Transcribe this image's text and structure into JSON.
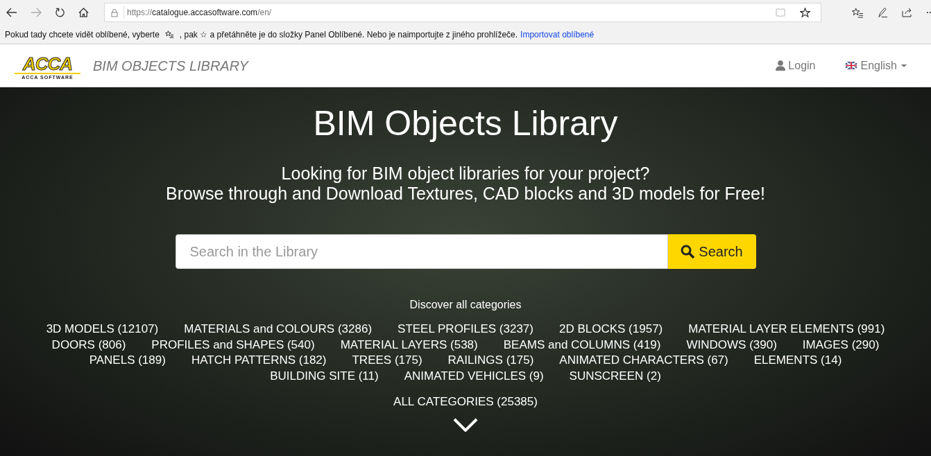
{
  "browser": {
    "url_prefix": "https://",
    "url_host": "catalogue.accasoftware.com",
    "url_path": "/en/"
  },
  "favorites_bar": {
    "text_before": "Pokud tady chcete vidět oblíbené, vyberte",
    "text_after": ", pak ☆ a přetáhněte je do složky Panel Oblíbené. Nebo je naimportujte z jiného prohlížeče.",
    "link": "Importovat oblíbené"
  },
  "header": {
    "logo": "ACCA",
    "logo_caption": "ACCA SOFTWARE",
    "site_title": "BIM OBJECTS LIBRARY",
    "login": "Login",
    "language": "English"
  },
  "hero": {
    "title": "BIM Objects Library",
    "subtitle_lines": [
      "Looking for BIM object libraries for your project?",
      "Browse through and Download Textures, CAD blocks and 3D models for Free!"
    ],
    "search": {
      "placeholder": "Search in the Library",
      "button": "Search"
    },
    "categories_heading": "Discover all categories",
    "category_rows": [
      [
        "3D MODELS (12107)",
        "MATERIALS and COLOURS (3286)",
        "STEEL PROFILES (3237)",
        "2D BLOCKS (1957)",
        "MATERIAL LAYER ELEMENTS (991)"
      ],
      [
        "DOORS (806)",
        "PROFILES and SHAPES (540)",
        "MATERIAL LAYERS (538)",
        "BEAMS and COLUMNS (419)",
        "WINDOWS (390)",
        "IMAGES (290)"
      ],
      [
        "PANELS (189)",
        "HATCH PATTERNS (182)",
        "TREES (175)",
        "RAILINGS (175)",
        "ANIMATED CHARACTERS (67)",
        "ELEMENTS (14)"
      ],
      [
        "BUILDING SITE (11)",
        "ANIMATED VEHICLES (9)",
        "SUNSCREEN (2)"
      ]
    ],
    "all_categories": "ALL CATEGORIES (25385)"
  }
}
